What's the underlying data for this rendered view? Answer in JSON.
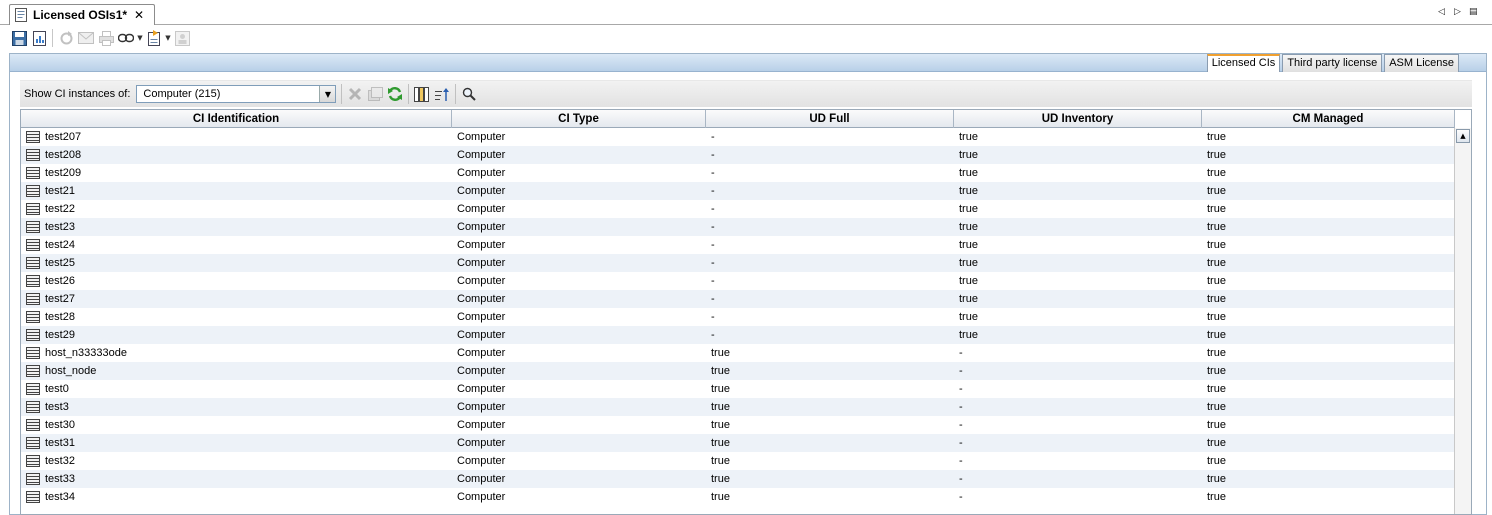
{
  "editor_tab": {
    "title": "Licensed OSIs1*",
    "close_glyph": "✕"
  },
  "window_controls": {
    "prev_glyph": "◁",
    "next_glyph": "▷",
    "menu_glyph": "▤"
  },
  "toolbar": {
    "icons": [
      "save-icon",
      "save-as-report-icon",
      "reload-icon",
      "email-icon",
      "print-icon",
      "link-icon",
      "export-icon",
      "properties-icon"
    ]
  },
  "view_tabs": [
    {
      "label": "Licensed CIs",
      "active": true
    },
    {
      "label": "Third party license",
      "active": false
    },
    {
      "label": "ASM License",
      "active": false
    }
  ],
  "filter": {
    "label": "Show CI instances of:",
    "selected": "Computer (215)"
  },
  "columns": [
    "CI Identification",
    "CI Type",
    "UD Full",
    "UD Inventory",
    "CM Managed"
  ],
  "rows": [
    [
      "test207",
      "Computer",
      "-",
      "true",
      "true"
    ],
    [
      "test208",
      "Computer",
      "-",
      "true",
      "true"
    ],
    [
      "test209",
      "Computer",
      "-",
      "true",
      "true"
    ],
    [
      "test21",
      "Computer",
      "-",
      "true",
      "true"
    ],
    [
      "test22",
      "Computer",
      "-",
      "true",
      "true"
    ],
    [
      "test23",
      "Computer",
      "-",
      "true",
      "true"
    ],
    [
      "test24",
      "Computer",
      "-",
      "true",
      "true"
    ],
    [
      "test25",
      "Computer",
      "-",
      "true",
      "true"
    ],
    [
      "test26",
      "Computer",
      "-",
      "true",
      "true"
    ],
    [
      "test27",
      "Computer",
      "-",
      "true",
      "true"
    ],
    [
      "test28",
      "Computer",
      "-",
      "true",
      "true"
    ],
    [
      "test29",
      "Computer",
      "-",
      "true",
      "true"
    ],
    [
      "host_n33333ode",
      "Computer",
      "true",
      "-",
      "true"
    ],
    [
      "host_node",
      "Computer",
      "true",
      "-",
      "true"
    ],
    [
      "test0",
      "Computer",
      "true",
      "-",
      "true"
    ],
    [
      "test3",
      "Computer",
      "true",
      "-",
      "true"
    ],
    [
      "test30",
      "Computer",
      "true",
      "-",
      "true"
    ],
    [
      "test31",
      "Computer",
      "true",
      "-",
      "true"
    ],
    [
      "test32",
      "Computer",
      "true",
      "-",
      "true"
    ],
    [
      "test33",
      "Computer",
      "true",
      "-",
      "true"
    ],
    [
      "test34",
      "Computer",
      "true",
      "-",
      "true"
    ]
  ]
}
